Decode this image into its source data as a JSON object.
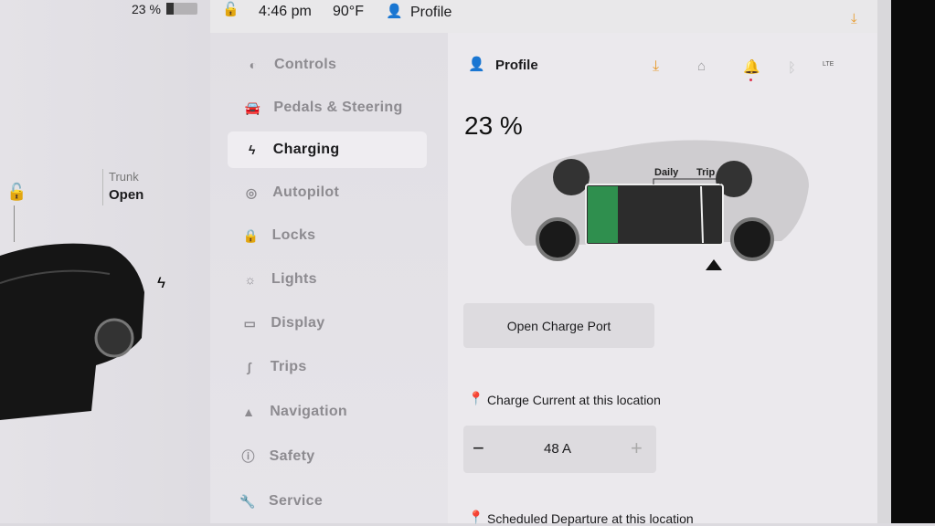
{
  "status_bar": {
    "battery": "23 %",
    "battery_level": 0.23,
    "time": "4:46 pm",
    "temperature": "90°F",
    "profile": "Profile"
  },
  "left_panel": {
    "trunk_label": "Trunk",
    "trunk_state": "Open"
  },
  "menu": {
    "items": [
      {
        "label": "Controls",
        "icon": "toggle-icon"
      },
      {
        "label": "Pedals & Steering",
        "icon": "car-icon"
      },
      {
        "label": "Charging",
        "icon": "bolt-icon",
        "selected": true
      },
      {
        "label": "Autopilot",
        "icon": "steering-wheel-icon"
      },
      {
        "label": "Locks",
        "icon": "lock-icon"
      },
      {
        "label": "Lights",
        "icon": "sun-icon"
      },
      {
        "label": "Display",
        "icon": "display-icon"
      },
      {
        "label": "Trips",
        "icon": "trips-icon"
      },
      {
        "label": "Navigation",
        "icon": "navigation-arrow-icon"
      },
      {
        "label": "Safety",
        "icon": "alert-circle-icon"
      },
      {
        "label": "Service",
        "icon": "wrench-icon"
      }
    ]
  },
  "header": {
    "profile": "Profile",
    "lte": "LTE",
    "accent": "#e89a2c"
  },
  "charging": {
    "percent": "23 %",
    "battery_level": 0.23,
    "daily_label": "Daily",
    "trip_label": "Trip",
    "open_port": "Open Charge Port",
    "current_label": "Charge Current at this location",
    "current_value": "48 A",
    "minus": "−",
    "plus": "+",
    "scheduled_label": "Scheduled Departure at this location",
    "green": "#2f8f4e"
  }
}
